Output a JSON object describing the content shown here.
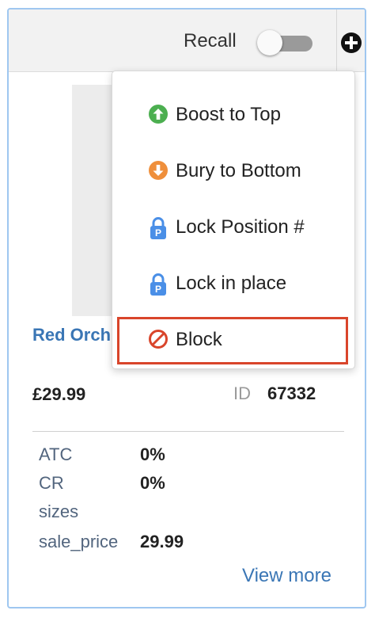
{
  "header": {
    "recall_label": "Recall",
    "recall_toggle": "off"
  },
  "product": {
    "title": "Red Orch",
    "price": "£29.99",
    "id_label": "ID",
    "id_value": "67332"
  },
  "stats": [
    {
      "key": "ATC",
      "value": "0%"
    },
    {
      "key": "CR",
      "value": "0%"
    },
    {
      "key": "sizes",
      "value": ""
    },
    {
      "key": "sale_price",
      "value": "29.99"
    }
  ],
  "view_more_label": "View more",
  "menu": {
    "items": [
      {
        "label": "Boost to Top",
        "icon": "arrow-up-circle-icon",
        "color": "#4caf50"
      },
      {
        "label": "Bury to Bottom",
        "icon": "arrow-down-circle-icon",
        "color": "#ef8f3b"
      },
      {
        "label": "Lock Position #",
        "icon": "padlock-icon",
        "color": "#4a8fe7"
      },
      {
        "label": "Lock in place",
        "icon": "padlock-icon",
        "color": "#4a8fe7"
      },
      {
        "label": "Block",
        "icon": "block-icon",
        "color": "#d9452b"
      }
    ],
    "highlighted": "Block"
  },
  "colors": {
    "accent_link": "#3a76b5",
    "highlight_border": "#d9452b"
  }
}
